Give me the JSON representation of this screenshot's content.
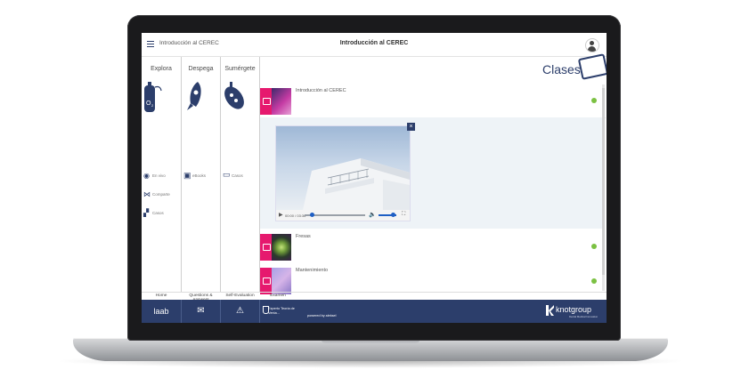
{
  "topbar": {
    "breadcrumb": "Introducción al CEREC",
    "title": "Introducción al CEREC",
    "menu_icon": "hamburger-icon",
    "avatar_icon": "user-avatar-icon"
  },
  "columns": [
    {
      "title": "Explora",
      "items": [
        "En vivo",
        "Comparte",
        "Casos"
      ]
    },
    {
      "title": "Despega",
      "items": [
        "eBooks"
      ]
    },
    {
      "title": "Sumérgete",
      "items": [
        "Casos"
      ]
    }
  ],
  "main": {
    "heading": "Clases",
    "lessons": [
      {
        "title": "Introducción al CEREC",
        "status": "completed"
      },
      {
        "title": "Fresas",
        "status": "completed"
      },
      {
        "title": "Mantenimiento",
        "status": "completed"
      }
    ],
    "video": {
      "time": "00:00 / 03:36",
      "close_label": "×",
      "progress": 0.12,
      "volume": 0.8
    }
  },
  "tabs": [
    "Home",
    "Questions & Answers",
    "Self-Evaluation",
    "Examen"
  ],
  "footer": {
    "brand": "laab",
    "school_line1": "Experto Teoría de",
    "school_line2": "Venta...",
    "powered": "powered by aleksel",
    "partner": "knotgroup",
    "partner_sub": "Dental Medical Innovation"
  },
  "colors": {
    "navy": "#2c3e6b",
    "accent_pink": "#e6196e",
    "status_green": "#7bc142"
  }
}
